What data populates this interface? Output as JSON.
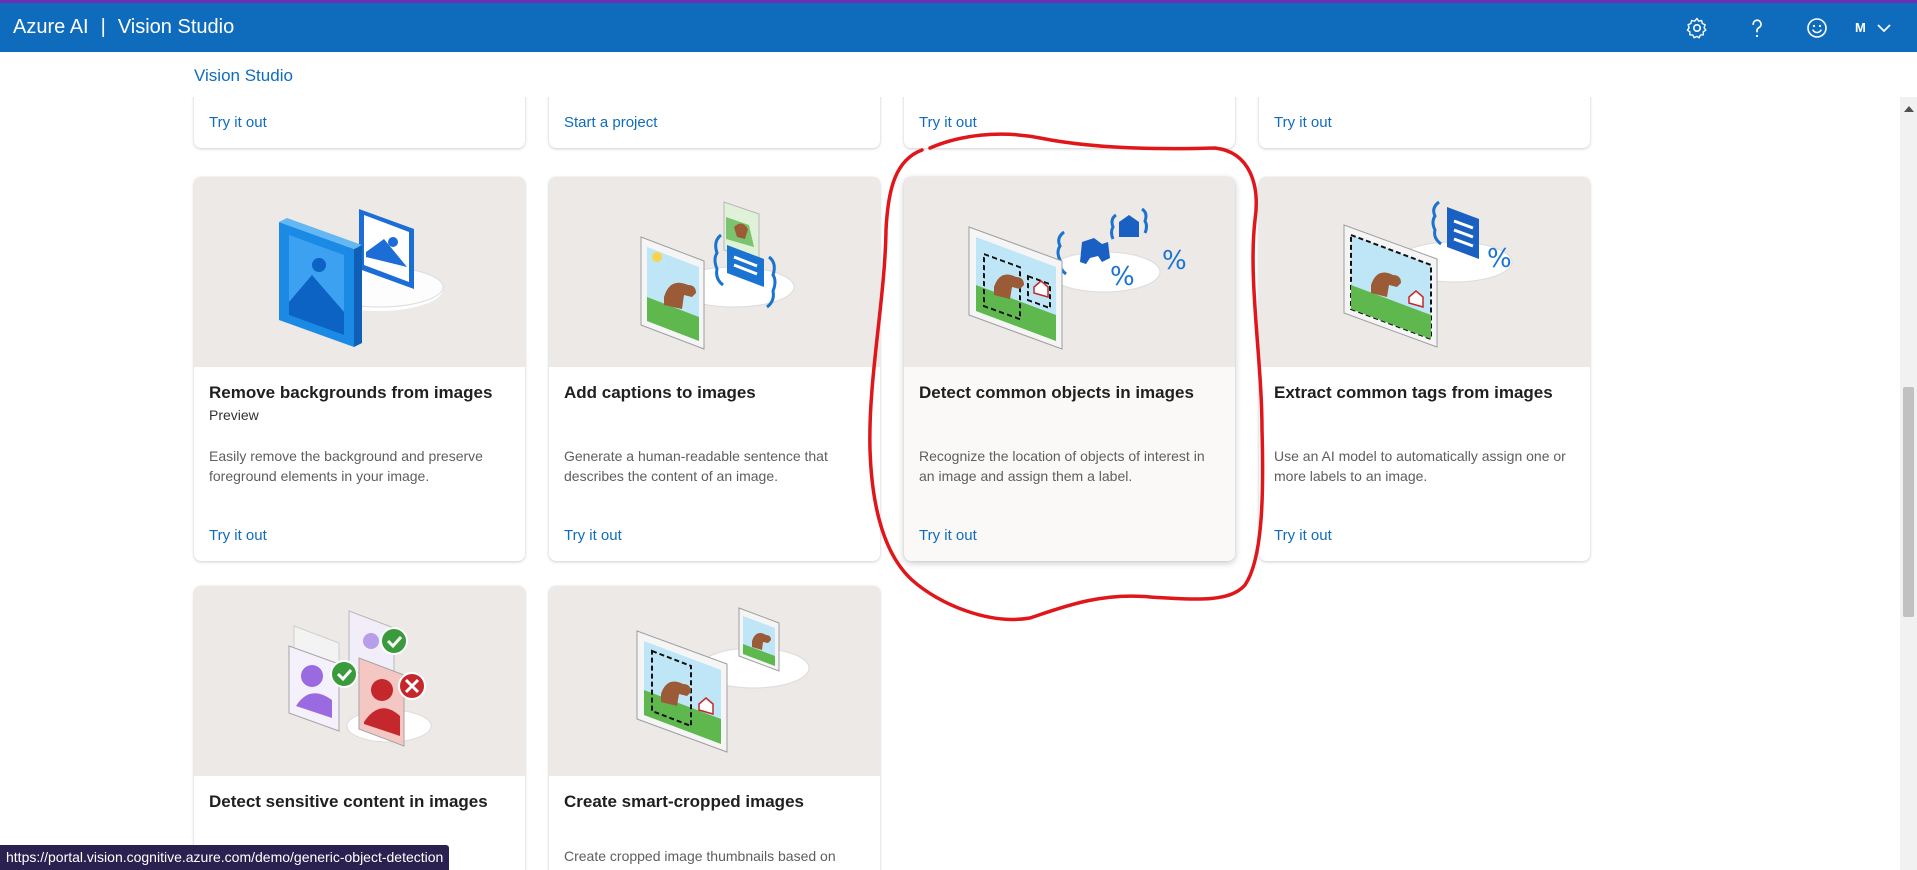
{
  "header": {
    "brand": "Azure AI",
    "separator": "|",
    "product": "Vision Studio",
    "account_initial": "M",
    "icons": [
      "settings-icon",
      "help-icon",
      "feedback-smiley-icon",
      "chevron-down-icon"
    ]
  },
  "breadcrumb": "Vision Studio",
  "top_row_cards": [
    {
      "link": "Try it out"
    },
    {
      "link": "Start a project"
    },
    {
      "link": "Try it out"
    },
    {
      "link": "Try it out"
    }
  ],
  "cards": [
    {
      "title": "Remove backgrounds from images",
      "badge": "Preview",
      "description": "Easily remove the background and preserve foreground elements in your image.",
      "link": "Try it out"
    },
    {
      "title": "Add captions to images",
      "badge": "",
      "description": "Generate a human-readable sentence that describes the content of an image.",
      "link": "Try it out"
    },
    {
      "title": "Detect common objects in images",
      "badge": "",
      "description": "Recognize the location of objects of interest in an image and assign them a label.",
      "link": "Try it out"
    },
    {
      "title": "Extract common tags from images",
      "badge": "",
      "description": "Use an AI model to automatically assign one or more labels to an image.",
      "link": "Try it out"
    },
    {
      "title": "Detect sensitive content in images",
      "badge": "",
      "description": "",
      "link": ""
    },
    {
      "title": "Create smart-cropped images",
      "badge": "",
      "description": "Create cropped image thumbnails based on",
      "link": ""
    }
  ],
  "status_url": "https://portal.vision.cognitive.azure.com/demo/generic-object-detection",
  "colors": {
    "header_bg": "#0f6cbd",
    "link": "#0f6cbd",
    "annotation": "#e0161b",
    "status_bg": "#2b2150"
  }
}
